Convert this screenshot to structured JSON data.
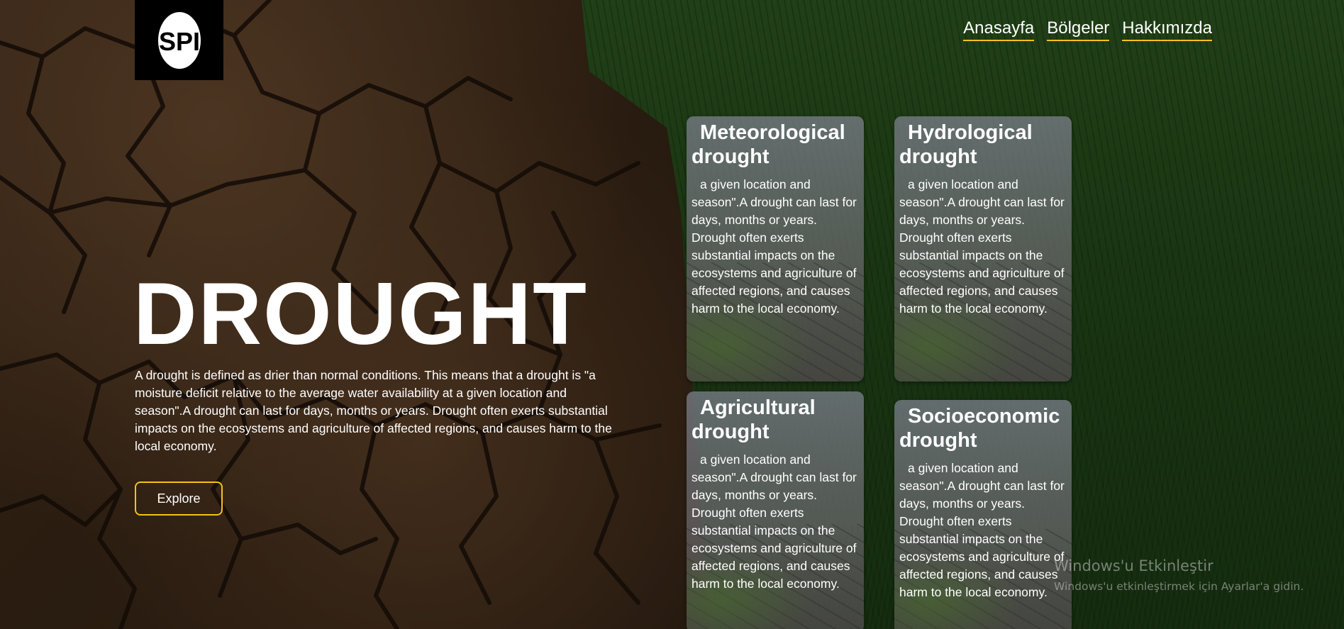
{
  "header": {
    "logo_text": "SPI",
    "nav": [
      "Anasayfa",
      "Bölgeler",
      "Hakkımızda"
    ]
  },
  "hero": {
    "title": "DROUGHT",
    "text": "A drought is defined as drier than normal conditions. This means that a drought is \"a moisture deficit relative to the average water availability at a given location and season\".A drought can last for days, months or years. Drought often exerts substantial impacts on the ecosystems and agriculture of affected regions, and causes harm to the local economy.",
    "button_label": "Explore"
  },
  "cards": [
    {
      "title": "Meteorological drought",
      "text": "a given location and season\".A drought can last for days, months or years. Drought often exerts substantial impacts on the ecosystems and agriculture of affected regions, and causes harm to the local economy."
    },
    {
      "title": "Hydrological drought",
      "text": "a given location and season\".A drought can last for days, months or years. Drought often exerts substantial impacts on the ecosystems and agriculture of affected regions, and causes harm to the local economy."
    },
    {
      "title": "Agricultural drought",
      "text": "a given location and season\".A drought can last for days, months or years. Drought often exerts substantial impacts on the ecosystems and agriculture of affected regions, and causes harm to the local economy."
    },
    {
      "title": "Socioeconomic drought",
      "text": "a given location and season\".A drought can last for days, months or years. Drought often exerts substantial impacts on the ecosystems and agriculture of affected regions, and causes harm to the local economy."
    }
  ],
  "watermark": {
    "title": "Windows'u Etkinleştir",
    "subtitle": "Windows'u etkinleştirmek için Ayarlar'a gidin."
  },
  "colors": {
    "accent": "#f2c21b",
    "text": "#ffffff",
    "logo_bg": "#000000"
  }
}
